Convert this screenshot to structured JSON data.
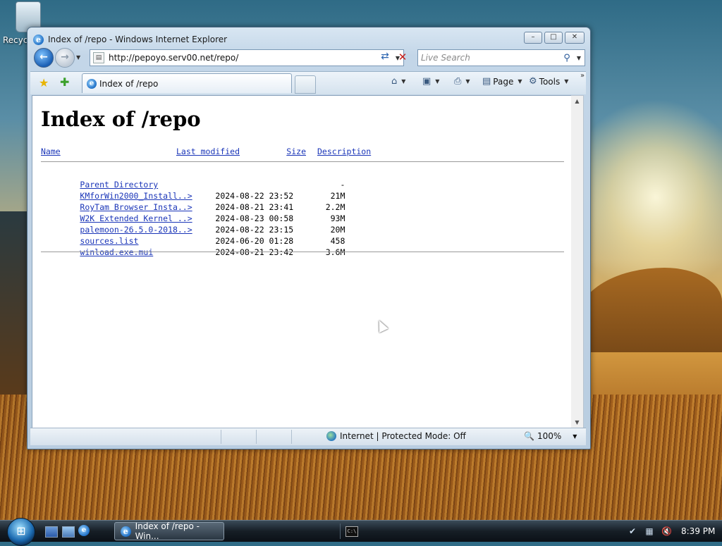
{
  "desktop": {
    "recycle_bin_label": "Recyc"
  },
  "window": {
    "title": "Index of /repo - Windows Internet Explorer",
    "address": "http://pepoyo.serv00.net/repo/",
    "search_placeholder": "Live Search",
    "tab_label": "Index of /repo",
    "toolbar": {
      "page_label": "Page",
      "tools_label": "Tools"
    }
  },
  "page": {
    "heading": "Index of /repo",
    "headers": {
      "name": "Name",
      "modified": "Last modified",
      "size": "Size",
      "description": "Description"
    },
    "entries": [
      {
        "name": "Parent Directory",
        "modified": "",
        "size": "-"
      },
      {
        "name": "KMforWin2000_Install..>",
        "modified": "2024-08-22 23:52",
        "size": "21M"
      },
      {
        "name": "RoyTam Browser Insta..>",
        "modified": "2024-08-21 23:41",
        "size": "2.2M"
      },
      {
        "name": "W2K Extended Kernel ..>",
        "modified": "2024-08-23 00:58",
        "size": "93M"
      },
      {
        "name": "palemoon-26.5.0-2018..>",
        "modified": "2024-08-22 23:15",
        "size": "20M"
      },
      {
        "name": "sources.list",
        "modified": "2024-06-20 01:28",
        "size": "458"
      },
      {
        "name": "winload.exe.mui",
        "modified": "2024-08-21 23:42",
        "size": "3.6M"
      }
    ]
  },
  "statusbar": {
    "zone": "Internet | Protected Mode: Off",
    "zoom": "100%"
  },
  "taskbar": {
    "window_button_label": "Index of /repo - Win...",
    "clock": "8:39 PM"
  },
  "colors": {
    "link": "#1a35b8",
    "window_frame": "#c3d6e8"
  }
}
